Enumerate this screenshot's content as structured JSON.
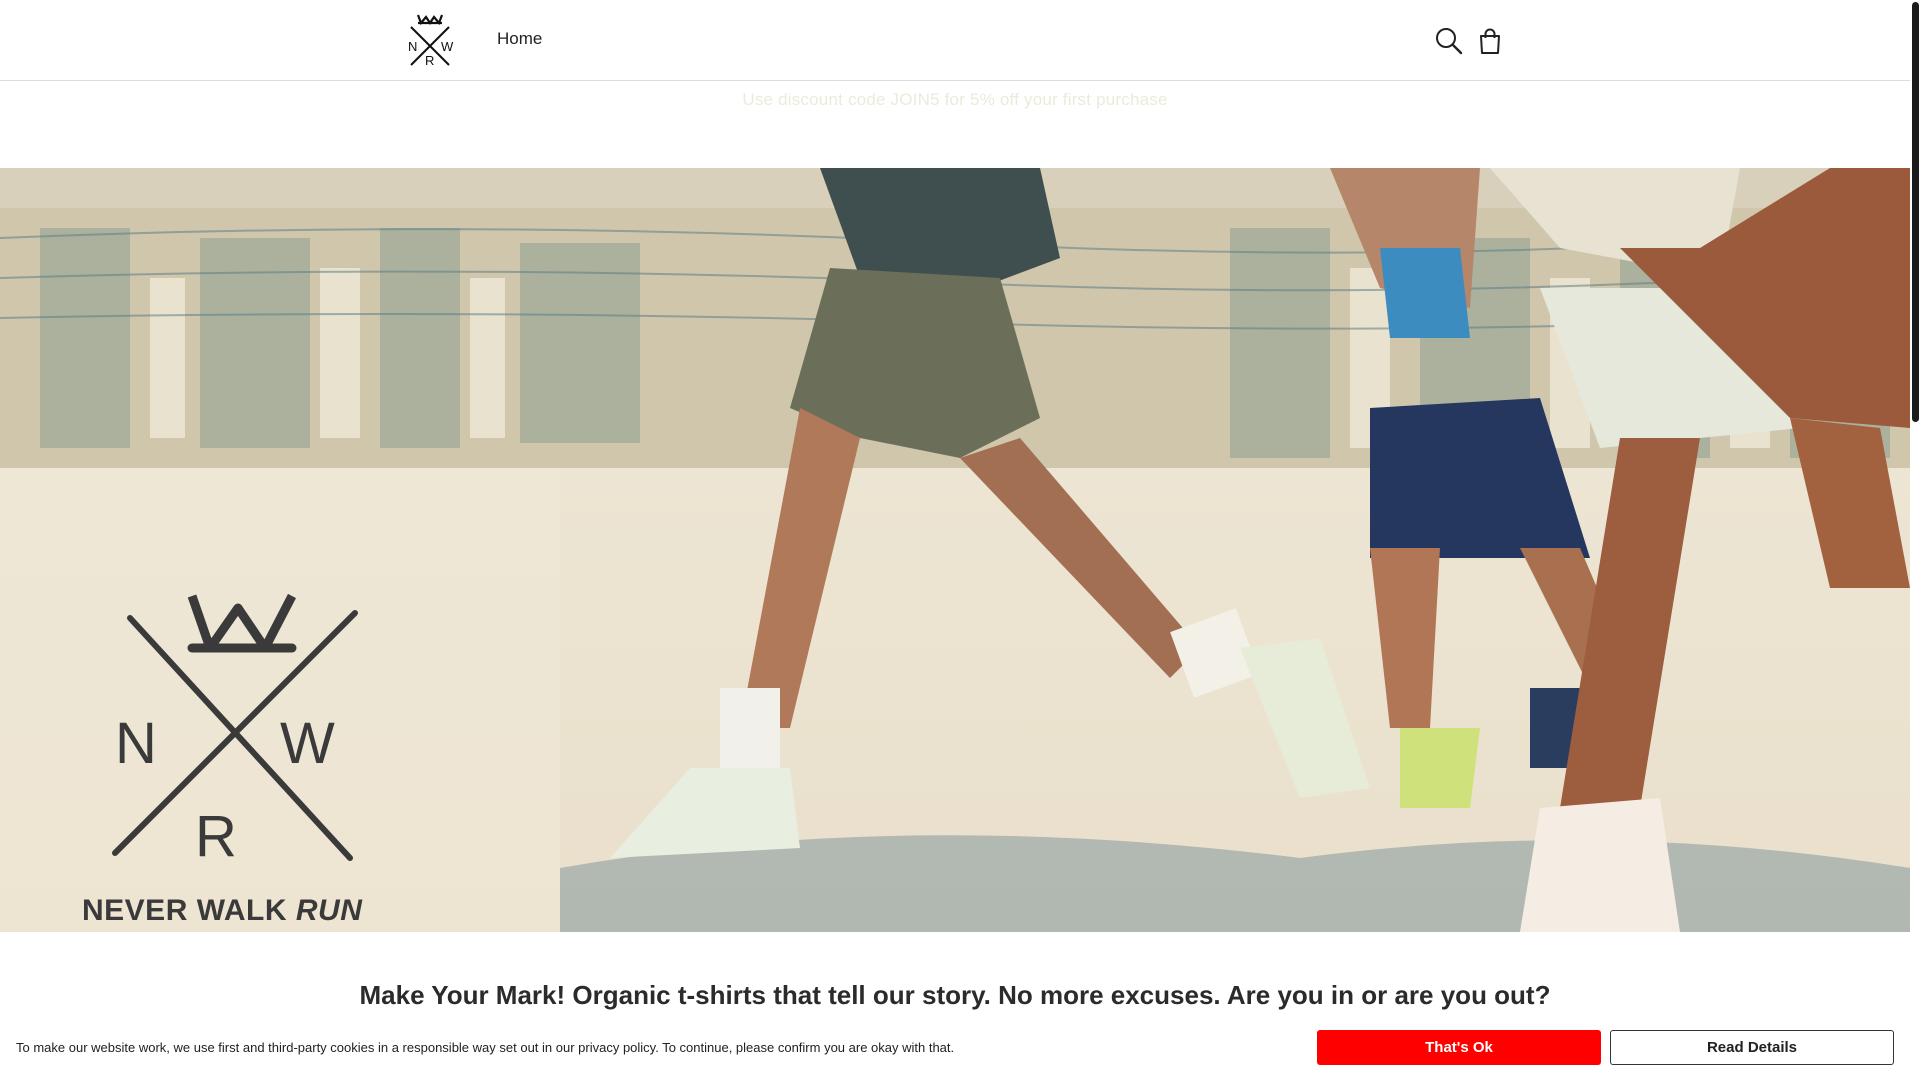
{
  "header": {
    "logo_letters": [
      "N",
      "W",
      "R"
    ],
    "nav_home": "Home",
    "icons": [
      "search-icon",
      "shopping-bag-icon"
    ]
  },
  "announcement": {
    "text": "Use discount code JOIN5 for 5% off your first purchase"
  },
  "hero": {
    "brand_name_prefix": "NEVER WALK ",
    "brand_name_emphasis": "RUN",
    "brand_letters": [
      "N",
      "W",
      "R"
    ]
  },
  "tagline": "Make Your Mark! Organic t-shirts that tell our story. No more excuses. Are you in or are you out?",
  "cookie_bar": {
    "text": "To make our website work, we use first and third-party cookies in a responsible way set out in our privacy policy. To continue, please confirm you are okay with that.",
    "accept_label": "That's Ok",
    "details_label": "Read Details"
  },
  "colors": {
    "accept_button": "#ff0000",
    "hero_background": "#e6dcc6",
    "brand_ink": "#3a3a3a"
  }
}
